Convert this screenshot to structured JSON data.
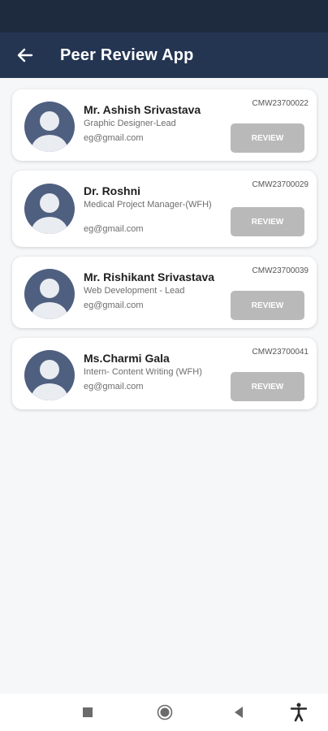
{
  "app_bar": {
    "title": "Peer Review App",
    "back_icon": "arrow-left-icon"
  },
  "colors": {
    "app_bar": "#243552",
    "status_bar": "#1e2a3e",
    "avatar_bg": "#4f5f80",
    "review_button": "#b9b9b9"
  },
  "employees": [
    {
      "name": "Mr. Ashish Srivastava",
      "role": "Graphic Designer-Lead",
      "email": "eg@gmail.com",
      "code": "CMW23700022",
      "review_label": "REVIEW"
    },
    {
      "name": "Dr. Roshni",
      "role": "Medical Project Manager-(WFH)",
      "email": "eg@gmail.com",
      "code": "CMW23700029",
      "review_label": "REVIEW"
    },
    {
      "name": "Mr. Rishikant Srivastava",
      "role": "Web Development - Lead",
      "email": "eg@gmail.com",
      "code": "CMW23700039",
      "review_label": "REVIEW"
    },
    {
      "name": "Ms.Charmi Gala",
      "role": "Intern- Content Writing (WFH)",
      "email": "eg@gmail.com",
      "code": "CMW23700041",
      "review_label": "REVIEW"
    }
  ],
  "system_nav": {
    "icons": [
      "recents-square-icon",
      "home-circle-icon",
      "back-triangle-icon",
      "accessibility-icon"
    ]
  }
}
